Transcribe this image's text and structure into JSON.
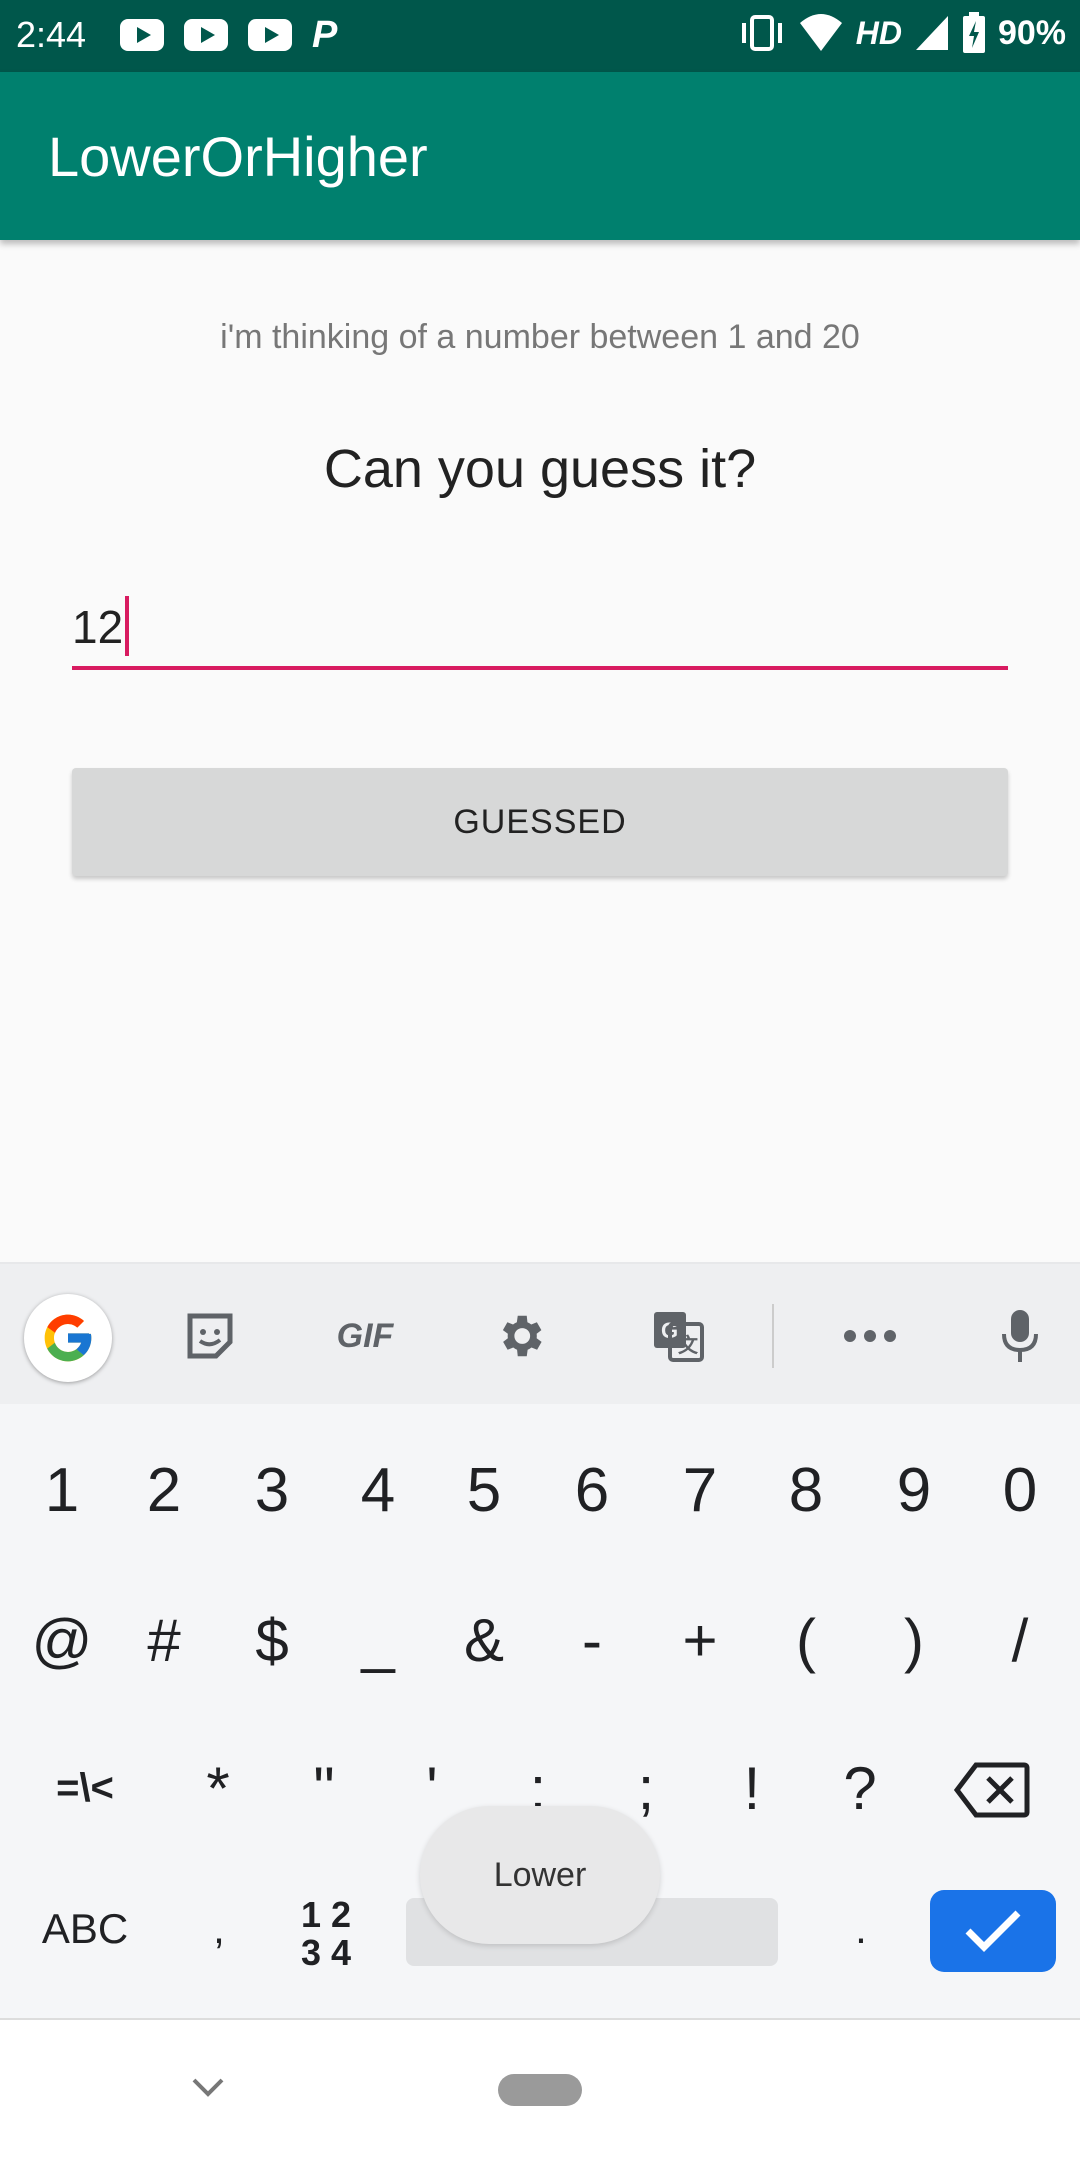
{
  "status": {
    "time": "2:44",
    "network": "HD",
    "battery": "90%",
    "left_icons": [
      "youtube-icon",
      "youtube-icon",
      "youtube-icon",
      "p-app-icon"
    ],
    "right_icons": [
      "vibrate-icon",
      "wifi-icon",
      "signal-icon",
      "battery-charging-icon"
    ]
  },
  "app": {
    "title": "LowerOrHigher"
  },
  "main": {
    "hint": "i'm thinking of a number between 1 and 20",
    "question": "Can you guess it?",
    "input_value": "12",
    "button_label": "GUESSED"
  },
  "keyboard": {
    "toolbar": [
      "google-icon",
      "sticker-icon",
      "GIF",
      "settings-icon",
      "translate-icon",
      "more-icon",
      "mic-icon"
    ],
    "gif_label": "GIF",
    "row1": [
      "1",
      "2",
      "3",
      "4",
      "5",
      "6",
      "7",
      "8",
      "9",
      "0"
    ],
    "row2": [
      "@",
      "#",
      "$",
      "_",
      "&",
      "-",
      "+",
      "(",
      ")",
      "/"
    ],
    "row3": [
      "=\\<",
      "*",
      "\"",
      "'",
      ":",
      ";",
      "!",
      "?"
    ],
    "row4": {
      "abc": "ABC",
      "comma": ",",
      "num_top": "1 2",
      "num_bottom": "3 4",
      "period": "."
    }
  },
  "toast": "Lower",
  "colors": {
    "primary": "#00806e",
    "primary_dark": "#00574b",
    "accent": "#d81b60",
    "enter": "#1a73e8"
  }
}
